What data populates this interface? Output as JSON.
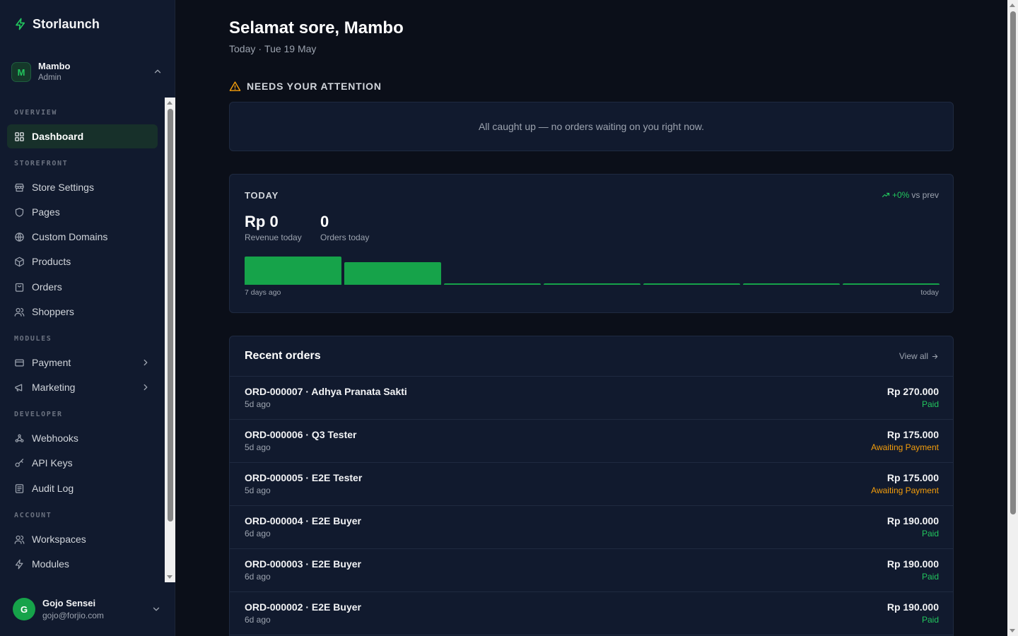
{
  "brand": {
    "name": "Storlaunch"
  },
  "workspace": {
    "initial": "M",
    "name": "Mambo",
    "role": "Admin"
  },
  "nav": {
    "sections": [
      {
        "label": "OVERVIEW",
        "items": [
          {
            "label": "Dashboard",
            "icon": "grid-icon",
            "active": true
          }
        ]
      },
      {
        "label": "STOREFRONT",
        "items": [
          {
            "label": "Store Settings",
            "icon": "store-icon"
          },
          {
            "label": "Pages",
            "icon": "shield-icon"
          },
          {
            "label": "Custom Domains",
            "icon": "globe-icon"
          },
          {
            "label": "Products",
            "icon": "package-icon"
          },
          {
            "label": "Orders",
            "icon": "shopping-bag-icon"
          },
          {
            "label": "Shoppers",
            "icon": "users-icon"
          }
        ]
      },
      {
        "label": "MODULES",
        "items": [
          {
            "label": "Payment",
            "icon": "credit-card-icon",
            "expandable": true
          },
          {
            "label": "Marketing",
            "icon": "megaphone-icon",
            "expandable": true
          }
        ]
      },
      {
        "label": "DEVELOPER",
        "items": [
          {
            "label": "Webhooks",
            "icon": "webhook-icon"
          },
          {
            "label": "API Keys",
            "icon": "key-icon"
          },
          {
            "label": "Audit Log",
            "icon": "log-icon"
          }
        ]
      },
      {
        "label": "ACCOUNT",
        "items": [
          {
            "label": "Workspaces",
            "icon": "users-icon"
          },
          {
            "label": "Modules",
            "icon": "bolt-icon"
          }
        ]
      }
    ]
  },
  "user": {
    "initial": "G",
    "name": "Gojo Sensei",
    "email": "gojo@forjio.com"
  },
  "header": {
    "greeting": "Selamat sore, Mambo",
    "date_prefix": "Today",
    "date_value": "Tue 19 May"
  },
  "attention": {
    "title": "NEEDS YOUR ATTENTION",
    "message": "All caught up — no orders waiting on you right now."
  },
  "today": {
    "label": "TODAY",
    "delta": "+0%",
    "delta_suffix": "vs prev",
    "revenue": "Rp 0",
    "revenue_label": "Revenue today",
    "orders": "0",
    "orders_label": "Orders today",
    "axis_start": "7 days ago",
    "axis_end": "today",
    "chart_data": {
      "type": "bar",
      "categories": [
        "d-6",
        "d-5",
        "d-4",
        "d-3",
        "d-2",
        "d-1",
        "d-0"
      ],
      "values": [
        1.0,
        0.8,
        0,
        0,
        0,
        0,
        0
      ],
      "ylim": [
        0,
        1
      ]
    }
  },
  "orders": {
    "title": "Recent orders",
    "view_all": "View all",
    "rows": [
      {
        "main": "ORD-000007 · Adhya Pranata Sakti",
        "age": "5d ago",
        "amount": "Rp 270.000",
        "status": "Paid",
        "kind": "paid"
      },
      {
        "main": "ORD-000006 · Q3 Tester",
        "age": "5d ago",
        "amount": "Rp 175.000",
        "status": "Awaiting Payment",
        "kind": "await"
      },
      {
        "main": "ORD-000005 · E2E Tester",
        "age": "5d ago",
        "amount": "Rp 175.000",
        "status": "Awaiting Payment",
        "kind": "await"
      },
      {
        "main": "ORD-000004 · E2E Buyer",
        "age": "6d ago",
        "amount": "Rp 190.000",
        "status": "Paid",
        "kind": "paid"
      },
      {
        "main": "ORD-000003 · E2E Buyer",
        "age": "6d ago",
        "amount": "Rp 190.000",
        "status": "Paid",
        "kind": "paid"
      },
      {
        "main": "ORD-000002 · E2E Buyer",
        "age": "6d ago",
        "amount": "Rp 190.000",
        "status": "Paid",
        "kind": "paid"
      }
    ]
  },
  "colors": {
    "accent": "#22c55e",
    "bar": "#16a34a",
    "warning": "#f59e0b",
    "background": "#0b0f19",
    "card": "#111a2e"
  }
}
